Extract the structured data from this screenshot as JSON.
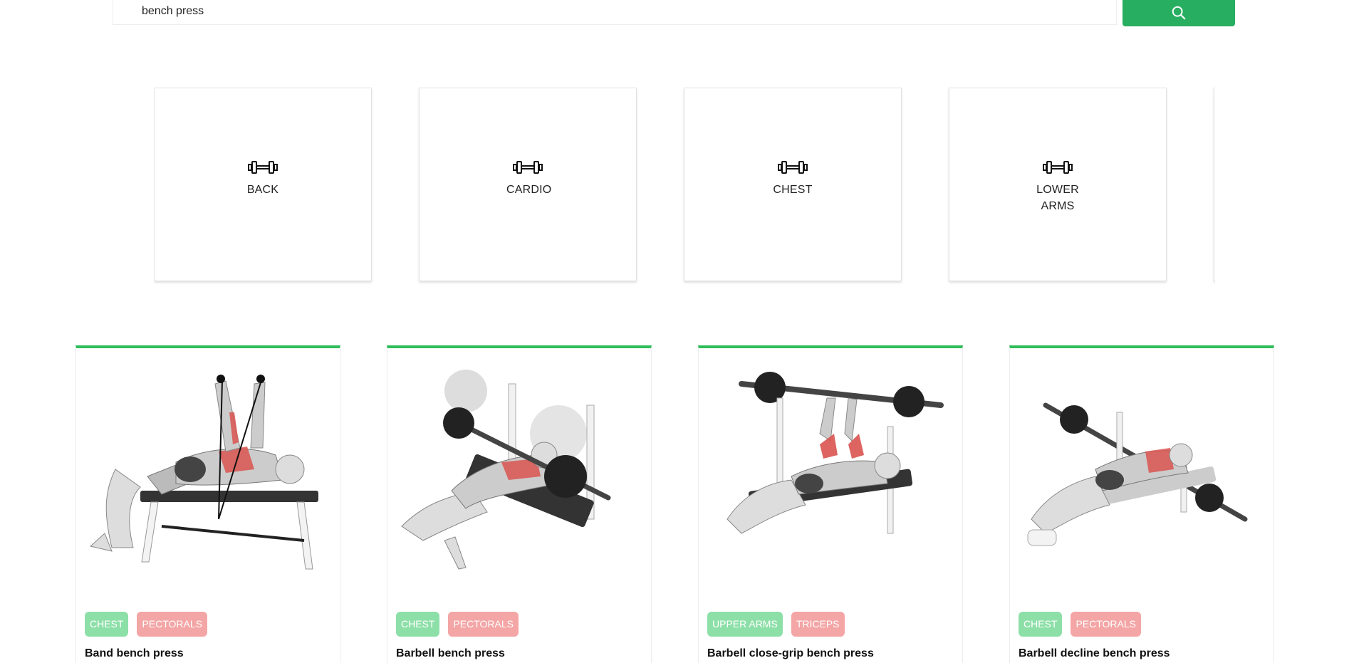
{
  "search": {
    "value": "bench press"
  },
  "body_parts": [
    {
      "label": "BACK"
    },
    {
      "label": "CARDIO"
    },
    {
      "label": "CHEST"
    },
    {
      "label": "LOWER ARMS"
    }
  ],
  "exercises": [
    {
      "name": "Band bench press",
      "tags": [
        "CHEST",
        "PECTORALS"
      ]
    },
    {
      "name": "Barbell bench press",
      "tags": [
        "CHEST",
        "PECTORALS"
      ]
    },
    {
      "name": "Barbell close-grip bench press",
      "tags": [
        "UPPER ARMS",
        "TRICEPS"
      ]
    },
    {
      "name": "Barbell decline bench press",
      "tags": [
        "CHEST",
        "PECTORALS"
      ]
    }
  ],
  "colors": {
    "accent": "#27ae60",
    "card_top_border": "#2ebd59",
    "tag_green": "#8ddfa8",
    "tag_red": "#f4a5a5"
  },
  "icons": {
    "search_button": "search-icon",
    "body_part": "dumbbell-icon"
  }
}
